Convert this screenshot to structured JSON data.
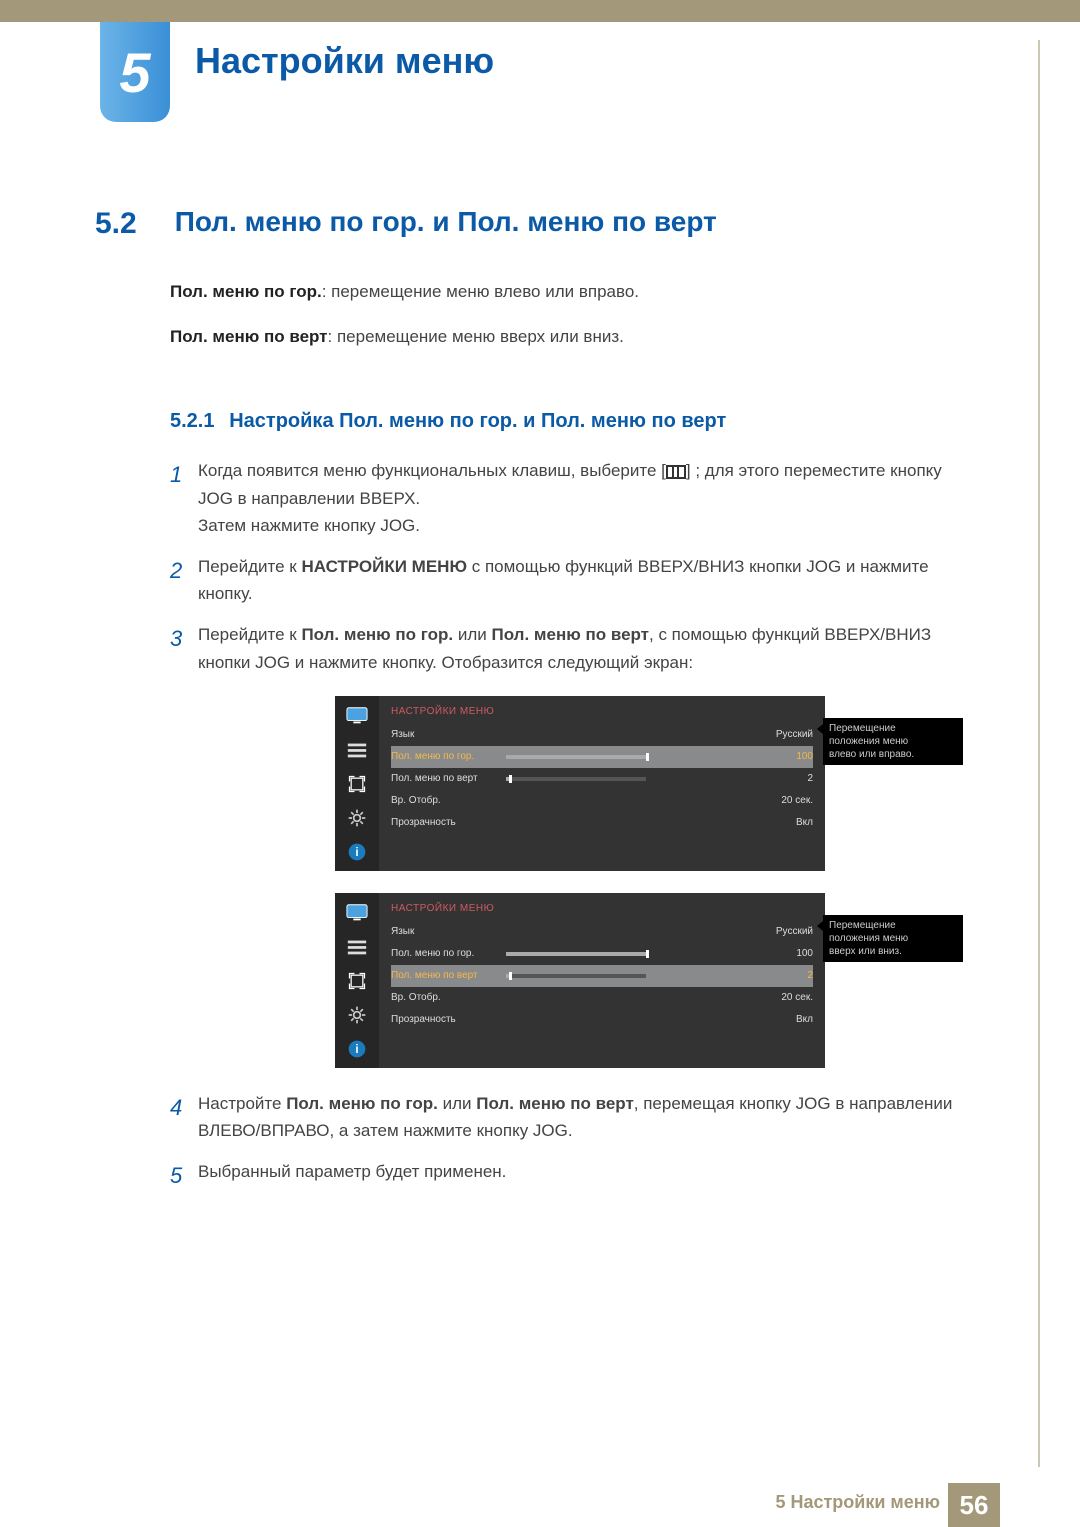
{
  "chapter": {
    "number": "5",
    "title": "Настройки меню"
  },
  "section": {
    "number": "5.2",
    "title": "Пол. меню по гор. и Пол. меню по верт"
  },
  "para1": {
    "bold": "Пол. меню по гор.",
    "text": ": перемещение меню влево или вправо."
  },
  "para2": {
    "bold": "Пол. меню по верт",
    "text": ": перемещение меню вверх или вниз."
  },
  "subsection": {
    "number": "5.2.1",
    "title": "Настройка Пол. меню по гор. и Пол. меню по верт"
  },
  "steps": {
    "s1a": "Когда появится меню функциональных клавиш, выберите [",
    "s1b": "] ; для этого переместите кнопку JOG в направлении ВВЕРХ.",
    "s1c": "Затем нажмите кнопку JOG.",
    "s2a": "Перейдите к ",
    "s2b": "НАСТРОЙКИ МЕНЮ",
    "s2c": " с помощью функций ВВЕРХ/ВНИЗ кнопки JOG и нажмите кнопку.",
    "s3a": "Перейдите к ",
    "s3b": "Пол. меню по гор.",
    "s3c": " или ",
    "s3d": "Пол. меню по верт",
    "s3e": ", с помощью функций ВВЕРХ/ВНИЗ кнопки JOG и нажмите кнопку. Отобразится следующий экран:",
    "s4a": "Настройте ",
    "s4b": "Пол. меню по гор.",
    "s4c": " или ",
    "s4d": "Пол. меню по верт",
    "s4e": ", перемещая кнопку JOG в направлении ВЛЕВО/ВПРАВО, а затем нажмите кнопку JOG.",
    "s5": "Выбранный параметр будет применен."
  },
  "num": {
    "n1": "1",
    "n2": "2",
    "n3": "3",
    "n4": "4",
    "n5": "5"
  },
  "osd": {
    "head": "НАСТРОЙКИ МЕНЮ",
    "lang_lbl": "Язык",
    "lang_val": "Русский",
    "hpos_lbl": "Пол. меню по гор.",
    "hpos_val": "100",
    "vpos_lbl": "Пол. меню по верт",
    "vpos_val": "2",
    "time_lbl": "Вр. Отобр.",
    "time_val": "20 сек.",
    "trans_lbl": "Прозрачность",
    "trans_val": "Вкл",
    "tip1a": "Перемещение",
    "tip1b": "положения меню",
    "tip1c": "влево или вправо.",
    "tip2a": "Перемещение",
    "tip2b": "положения меню",
    "tip2c": "вверх или вниз."
  },
  "footer": {
    "label": "5 Настройки меню",
    "page": "56"
  }
}
